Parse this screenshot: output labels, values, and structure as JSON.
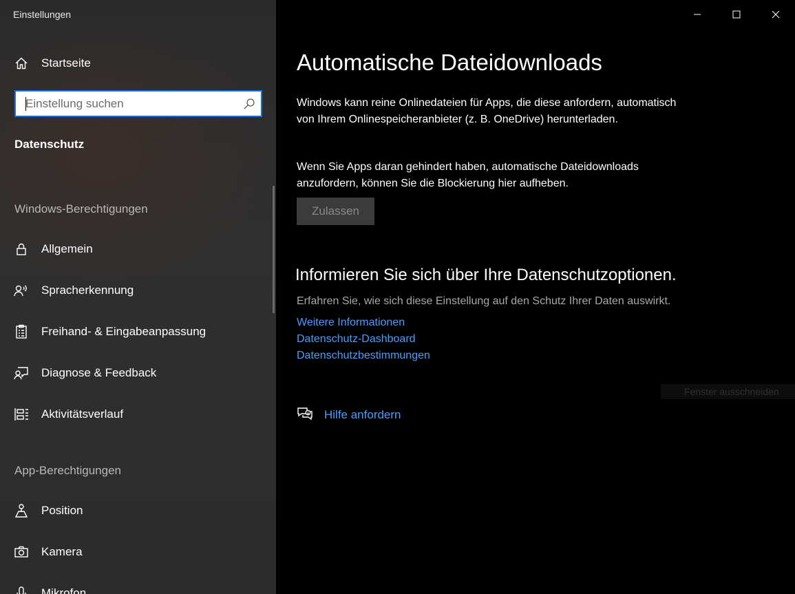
{
  "app": {
    "title": "Einstellungen"
  },
  "sidebar": {
    "home_label": "Startseite",
    "search_placeholder": "Einstellung suchen",
    "active_section": "Datenschutz",
    "groups": {
      "windows": "Windows-Berechtigungen",
      "app": "App-Berechtigungen"
    },
    "windows_items": [
      {
        "label": "Allgemein",
        "icon": "lock-icon"
      },
      {
        "label": "Spracherkennung",
        "icon": "speech-icon"
      },
      {
        "label": "Freihand- & Eingabeanpassung",
        "icon": "clipboard-icon"
      },
      {
        "label": "Diagnose & Feedback",
        "icon": "feedback-icon"
      },
      {
        "label": "Aktivitätsverlauf",
        "icon": "timeline-icon"
      }
    ],
    "app_items": [
      {
        "label": "Position",
        "icon": "location-icon"
      },
      {
        "label": "Kamera",
        "icon": "camera-icon"
      },
      {
        "label": "Mikrofon",
        "icon": "microphone-icon"
      }
    ]
  },
  "main": {
    "title": "Automatische Dateidownloads",
    "para1": "Windows kann reine Onlinedateien für Apps, die diese anfordern, automatisch von Ihrem Onlinespeicheranbieter (z. B. OneDrive) herunterladen.",
    "para2": "Wenn Sie Apps daran gehindert haben, automatische Dateidownloads anzufordern, können Sie die Blockierung hier aufheben.",
    "allow_button": "Zulassen",
    "privacy_heading": "Informieren Sie sich über Ihre Datenschutzoptionen.",
    "privacy_sub": "Erfahren Sie, wie sich diese Einstellung auf den Schutz Ihrer Daten auswirkt.",
    "links": [
      "Weitere Informationen",
      "Datenschutz-Dashboard",
      "Datenschutzbestimmungen"
    ],
    "ghost_text": "Fenster ausschneiden",
    "help_label": "Hilfe anfordern"
  },
  "colors": {
    "accent": "#1a73d8",
    "link": "#4a9eff",
    "sidebar_bg": "#2c2c2c",
    "main_bg": "#000000"
  }
}
